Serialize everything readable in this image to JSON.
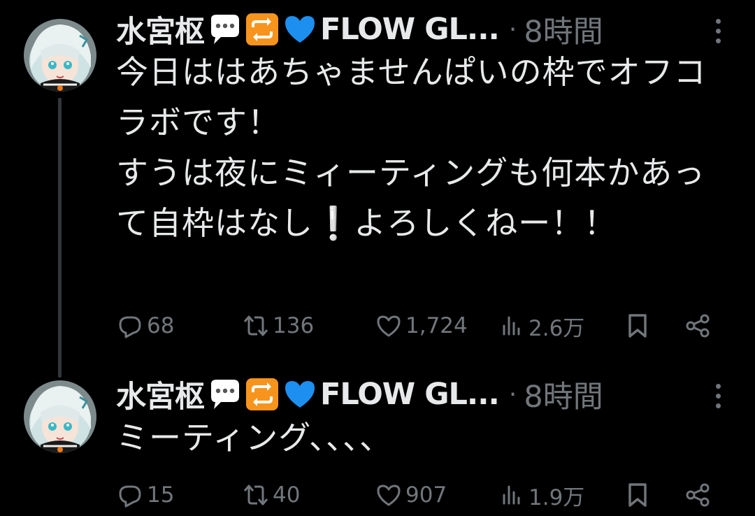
{
  "tweets": [
    {
      "display_name": "水宮枢",
      "name_suffix": "FLOW GL...",
      "separator": "·",
      "time": "8時間",
      "text": "今日ははあちゃませんぱいの枠でオフコラボです！\nすうは夜にミィーティングも何本かあって自枠はなし❕よろしくねー！！",
      "reply_count": "68",
      "retweet_count": "136",
      "like_count": "1,724",
      "view_count": "2.6万"
    },
    {
      "display_name": "水宮枢",
      "name_suffix": "FLOW GL...",
      "separator": "·",
      "time": "8時間",
      "text": "ミーティング、、、、",
      "reply_count": "15",
      "retweet_count": "40",
      "like_count": "907",
      "view_count": "1.9万"
    }
  ],
  "name_emojis": [
    "speech-balloon-emoji",
    "repeat-emoji",
    "blue-heart-emoji"
  ],
  "icons": {
    "reply": "reply-icon",
    "retweet": "retweet-icon",
    "like": "heart-icon",
    "views": "views-icon",
    "bookmark": "bookmark-icon",
    "share": "share-icon",
    "more": "more-dots-icon"
  },
  "colors": {
    "background": "#000000",
    "text": "#e7e9ea",
    "muted": "#71767b",
    "thread_line": "#333639",
    "heart_emoji": "#1d8ff0",
    "repeat_emoji": "#f7941d"
  }
}
